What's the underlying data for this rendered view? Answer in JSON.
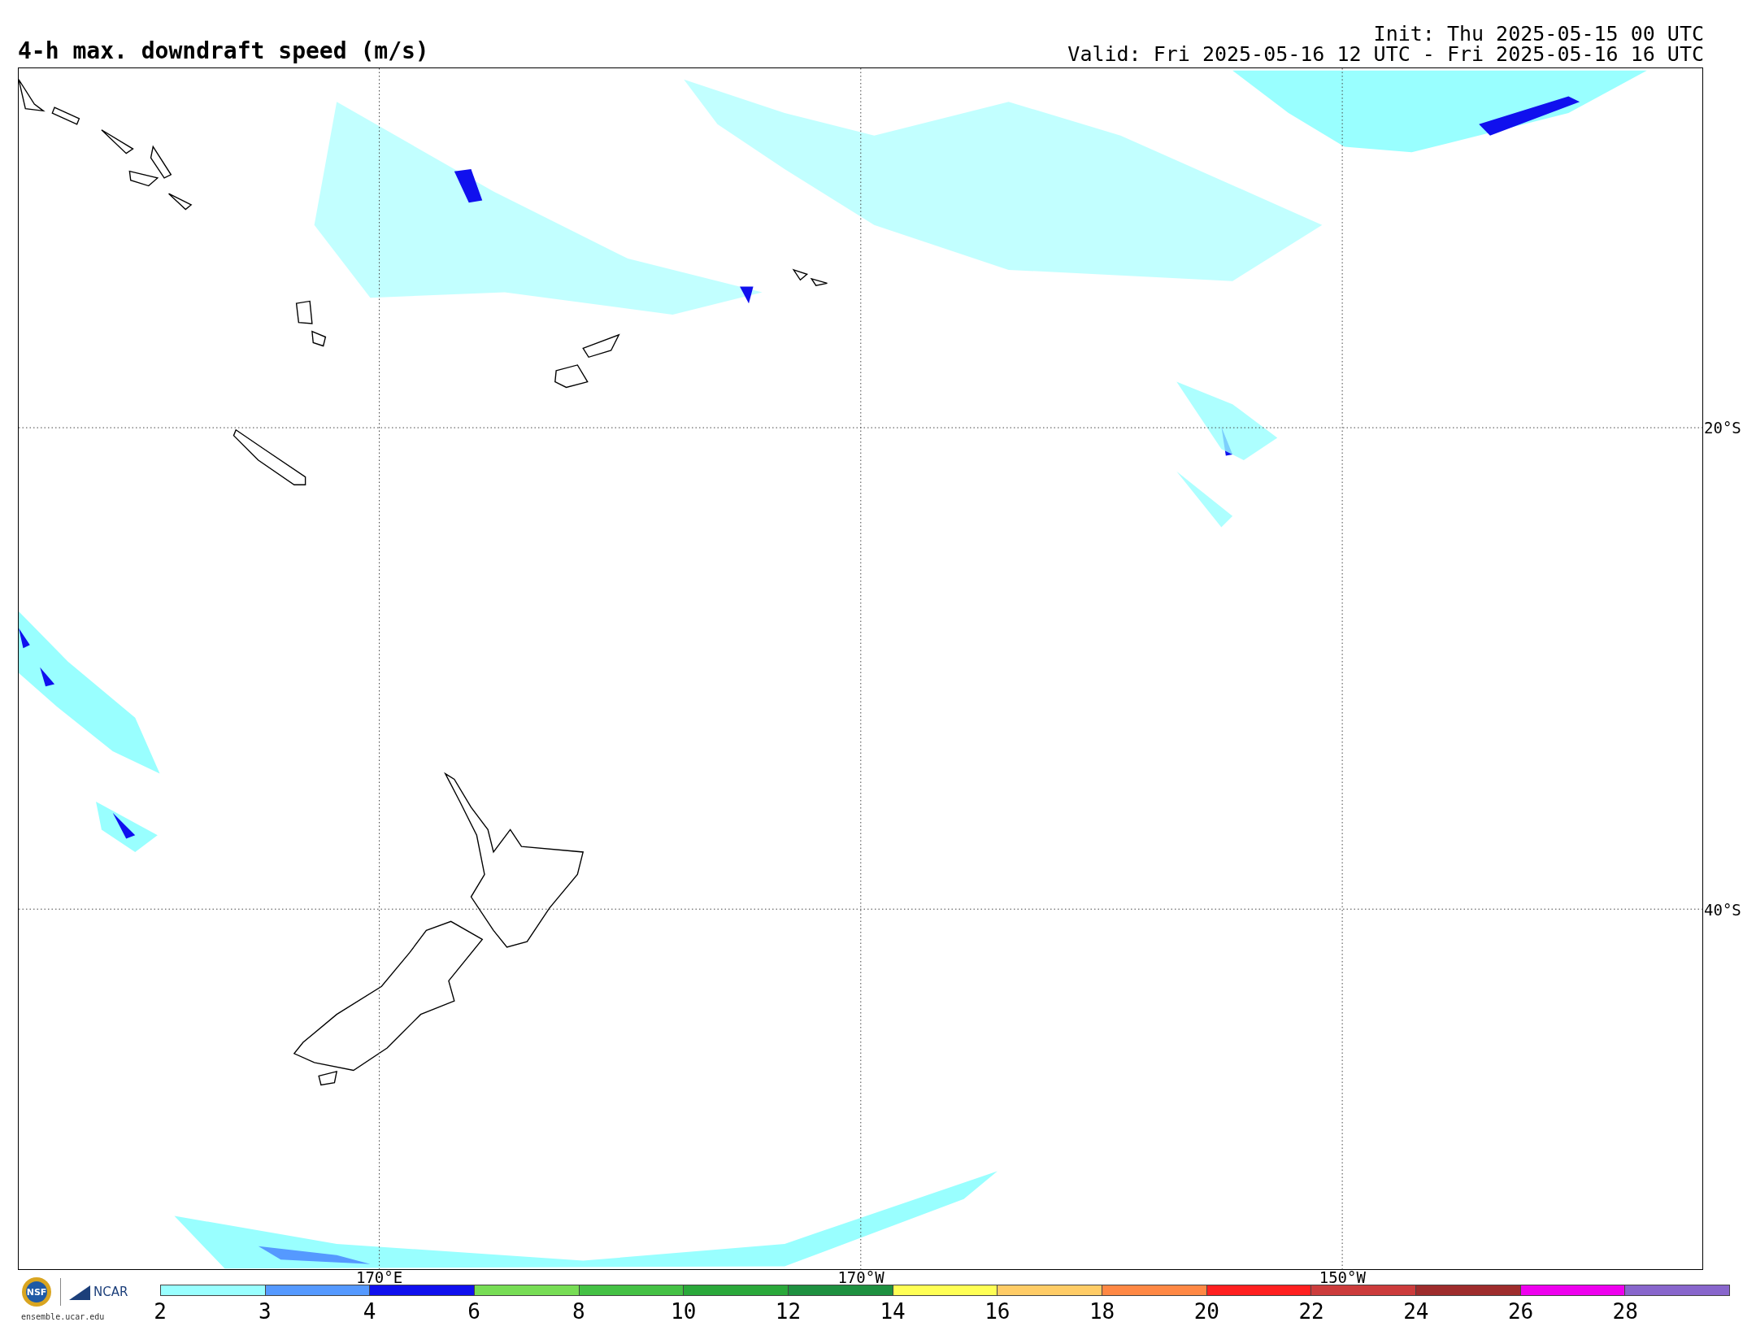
{
  "title": "4-h max. downdraft speed (m/s)",
  "init": "Init: Thu 2025-05-15 00 UTC",
  "valid": "Valid: Fri 2025-05-16 12 UTC - Fri 2025-05-16 16 UTC",
  "map": {
    "lat_labels": [
      "20°S",
      "40°S"
    ],
    "lon_labels": [
      "170°E",
      "170°W",
      "150°W"
    ]
  },
  "logos": {
    "nsf": "NSF",
    "ncar": "NCAR",
    "url": "ensemble.ucar.edu"
  },
  "colorbar": {
    "ticks": [
      "2",
      "3",
      "4",
      "6",
      "8",
      "10",
      "12",
      "14",
      "16",
      "18",
      "20",
      "22",
      "24",
      "26",
      "28"
    ],
    "bins": [
      {
        "color": "#99ffff"
      },
      {
        "color": "#5599ff"
      },
      {
        "color": "#1010ee"
      },
      {
        "color": "#77dd55"
      },
      {
        "color": "#44c144"
      },
      {
        "color": "#2aa83a"
      },
      {
        "color": "#1e9040"
      },
      {
        "color": "#ffff55"
      },
      {
        "color": "#ffcc66"
      },
      {
        "color": "#ff8844"
      },
      {
        "color": "#ff2020"
      },
      {
        "color": "#cc3c3c"
      },
      {
        "color": "#9e2c2c"
      },
      {
        "color": "#ee00ee"
      },
      {
        "color": "#8866cc"
      }
    ]
  }
}
